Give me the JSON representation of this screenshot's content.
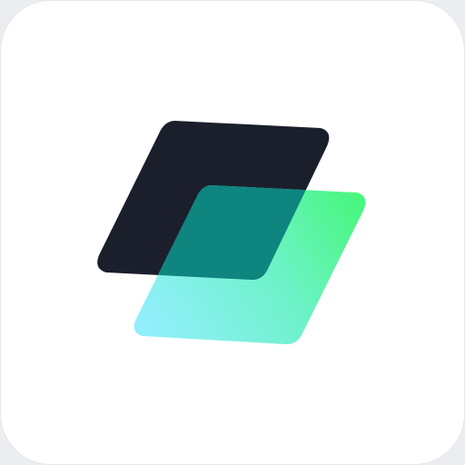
{
  "app_icon": {
    "icon_name": "stacked-layers-logo-icon",
    "colors": {
      "tile_background": "#ffffff",
      "back_layer": "#1a1f2b",
      "front_layer_gradient_start": "#93eefe",
      "front_layer_gradient_mid": "#6ef2c9",
      "front_layer_gradient_end": "#46f77a",
      "overlap_tint": "#0f8580"
    }
  }
}
